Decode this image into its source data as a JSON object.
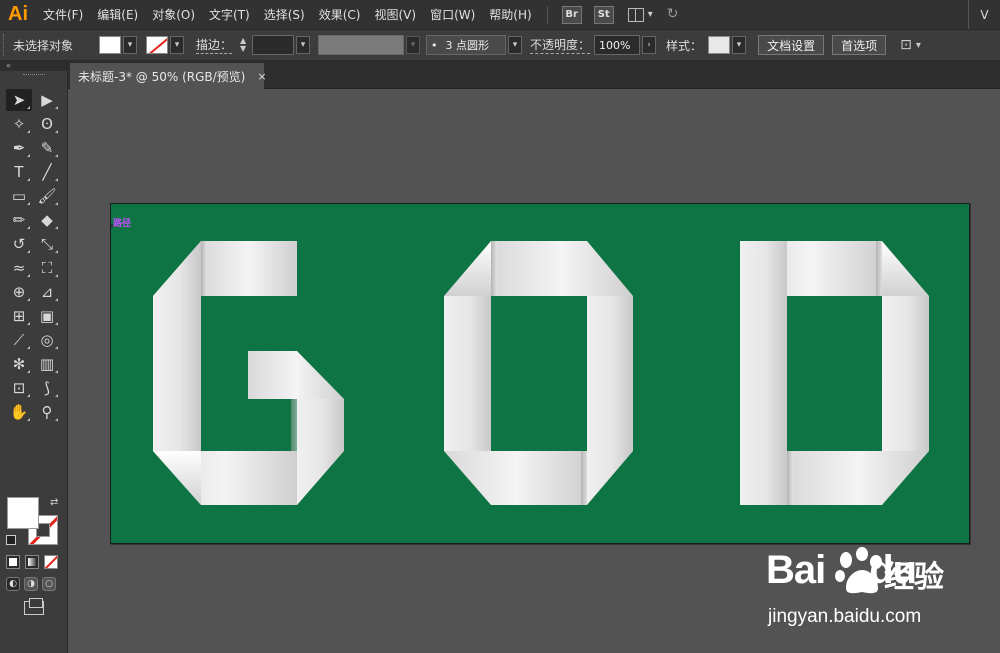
{
  "app": {
    "logo": "Ai"
  },
  "menu": [
    "文件(F)",
    "编辑(E)",
    "对象(O)",
    "文字(T)",
    "选择(S)",
    "效果(C)",
    "视图(V)",
    "窗口(W)",
    "帮助(H)"
  ],
  "bridge_badges": [
    "Br",
    "St"
  ],
  "menubar_right": "V",
  "control": {
    "selection": "未选择对象",
    "stroke_label": "描边：",
    "brush": "3 点圆形",
    "brush_dot": "•",
    "opacity_label": "不透明度：",
    "opacity_value": "100%",
    "style_label": "样式：",
    "doc_setup": "文档设置",
    "prefs": "首选项"
  },
  "tools_panel": {
    "collapse": "«"
  },
  "document": {
    "tab_title": "未标题-3* @ 50% (RGB/预览)",
    "close": "×"
  },
  "canvas": {
    "hint_label": "路径",
    "artboard_color": "#0f7444",
    "art_text": "GOD"
  },
  "watermark": {
    "logo": "Bai",
    "logo_tail": "du",
    "cn": "经验",
    "url": "jingyan.baidu.com"
  }
}
